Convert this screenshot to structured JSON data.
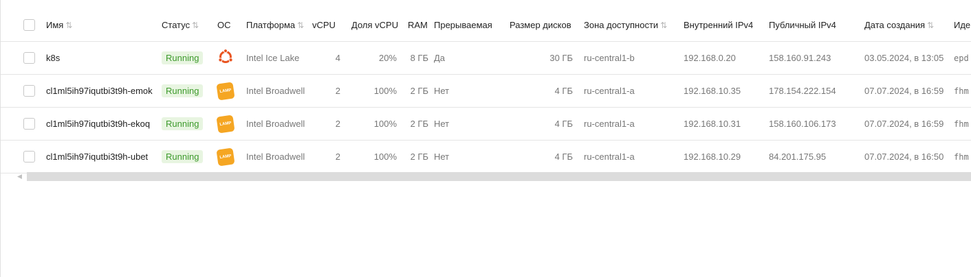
{
  "table": {
    "columns": {
      "name": "Имя",
      "status": "Статус",
      "os": "ОС",
      "platform": "Платформа",
      "vcpu": "vCPU",
      "vcpu_share": "Доля vCPU",
      "ram": "RAM",
      "preemptible": "Прерываемая",
      "disk_size": "Размер дисков",
      "zone": "Зона доступности",
      "internal_ip": "Внутренний IPv4",
      "public_ip": "Публичный IPv4",
      "created": "Дата создания",
      "id": "Иде"
    },
    "sort_glyph": "⇅",
    "rows": [
      {
        "name": "k8s",
        "status": "Running",
        "os": "ubuntu-icon",
        "platform": "Intel Ice Lake",
        "vcpu": "4",
        "vcpu_share": "20%",
        "ram": "8 ГБ",
        "preemptible": "Да",
        "disk_size": "30 ГБ",
        "zone": "ru-central1-b",
        "internal_ip": "192.168.0.20",
        "public_ip": "158.160.91.243",
        "created": "03.05.2024, в 13:05",
        "id": "epd"
      },
      {
        "name": "cl1ml5ih97iqutbi3t9h-emok",
        "status": "Running",
        "os": "lamp-icon",
        "os_label": "LAMP",
        "platform": "Intel Broadwell",
        "vcpu": "2",
        "vcpu_share": "100%",
        "ram": "2 ГБ",
        "preemptible": "Нет",
        "disk_size": "4 ГБ",
        "zone": "ru-central1-a",
        "internal_ip": "192.168.10.35",
        "public_ip": "178.154.222.154",
        "created": "07.07.2024, в 16:59",
        "id": "fhm"
      },
      {
        "name": "cl1ml5ih97iqutbi3t9h-ekoq",
        "status": "Running",
        "os": "lamp-icon",
        "os_label": "LAMP",
        "platform": "Intel Broadwell",
        "vcpu": "2",
        "vcpu_share": "100%",
        "ram": "2 ГБ",
        "preemptible": "Нет",
        "disk_size": "4 ГБ",
        "zone": "ru-central1-a",
        "internal_ip": "192.168.10.31",
        "public_ip": "158.160.106.173",
        "created": "07.07.2024, в 16:59",
        "id": "fhm"
      },
      {
        "name": "cl1ml5ih97iqutbi3t9h-ubet",
        "status": "Running",
        "os": "lamp-icon",
        "os_label": "LAMP",
        "platform": "Intel Broadwell",
        "vcpu": "2",
        "vcpu_share": "100%",
        "ram": "2 ГБ",
        "preemptible": "Нет",
        "disk_size": "4 ГБ",
        "zone": "ru-central1-a",
        "internal_ip": "192.168.10.29",
        "public_ip": "84.201.175.95",
        "created": "07.07.2024, в 16:50",
        "id": "fhm"
      }
    ]
  },
  "colors": {
    "status_bg": "#e8f5e1",
    "status_text": "#3d9a2c",
    "ubuntu": "#e95420",
    "lamp": "#f5a623"
  }
}
